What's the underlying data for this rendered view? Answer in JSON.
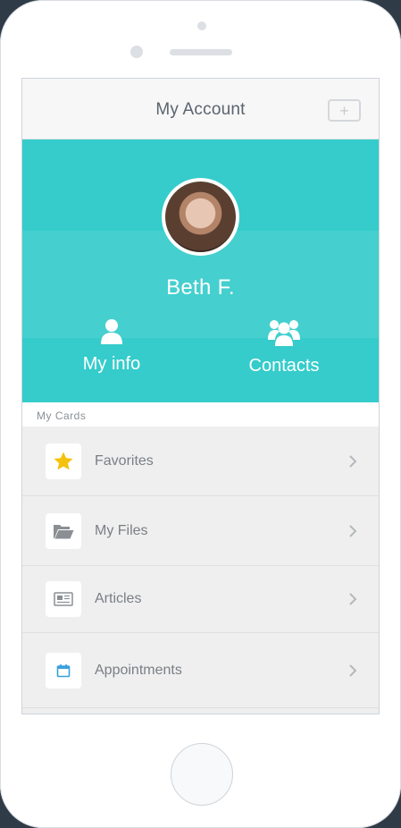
{
  "header": {
    "title": "My Account",
    "add_label": "+"
  },
  "profile": {
    "name": "Beth F."
  },
  "actions": [
    {
      "label": "My info",
      "icon": "user-icon"
    },
    {
      "label": "Contacts",
      "icon": "group-icon"
    }
  ],
  "section": {
    "label": "My Cards"
  },
  "cards": [
    {
      "label": "Favorites",
      "icon": "star-icon"
    },
    {
      "label": "My Files",
      "icon": "folder-open-icon"
    },
    {
      "label": "Articles",
      "icon": "newspaper-icon"
    },
    {
      "label": "Appointments",
      "icon": "calendar-icon"
    }
  ],
  "colors": {
    "accent": "#35cccb",
    "star": "#f4c20d",
    "calendar": "#3aa0dc"
  }
}
